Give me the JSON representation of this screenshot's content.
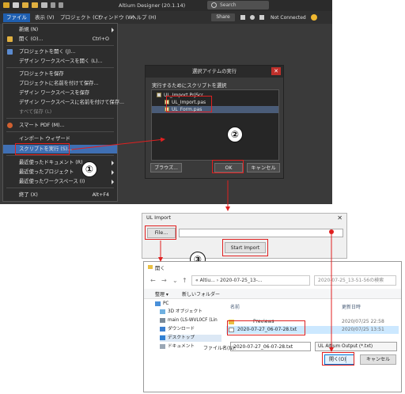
{
  "colors": {
    "accent_red": "#e02020",
    "menu_highlight": "#3f6fb3",
    "altium_bg": "#3a3a3a"
  },
  "altium": {
    "title": "Altium Designer (20.1.14)",
    "search_label": "Search",
    "share_label": "Share",
    "connection_status": "Not Connected",
    "menus": [
      "ファイル (F)",
      "表示 (V)",
      "プロジェクト (C)",
      "ウィンドウ (W)",
      "ヘルプ (H)"
    ],
    "file_menu": {
      "items": [
        {
          "label": "新規 (N)",
          "arrow": true
        },
        {
          "label": "開く (O)...",
          "shortcut": "Ctrl+O"
        },
        {
          "label": "プロジェクトを開く (J)..."
        },
        {
          "label": "デザイン ワークスペースを開く (L)..."
        },
        {
          "label": "プロジェクトを保存"
        },
        {
          "label": "プロジェクトに名前を付けて保存..."
        },
        {
          "label": "デザイン ワークスペースを保存"
        },
        {
          "label": "デザイン ワークスペースに名前を付けて保存..."
        },
        {
          "label": "すべて保存 (L)"
        },
        {
          "label": "スマート PDF (M)..."
        },
        {
          "label": "インポート ウィザード"
        },
        {
          "label": "スクリプトを実行 (S)..."
        },
        {
          "label": "最近使ったドキュメント (R)",
          "arrow": true
        },
        {
          "label": "最近使ったプロジェクト",
          "arrow": true
        },
        {
          "label": "最近使ったワークスペース (I)",
          "arrow": true
        },
        {
          "label": "終了 (X)",
          "shortcut": "Alt+F4"
        }
      ]
    }
  },
  "select_dialog": {
    "title": "選択アイテムの実行",
    "prompt": "実行するためにスクリプトを選択",
    "tree": [
      "UL_Import.PrjScr",
      "UL_Import.pas",
      "UL_Form.pas"
    ],
    "browse_label": "ブラウズ...",
    "ok_label": "OK",
    "cancel_label": "キャンセル"
  },
  "ul_form": {
    "title": "UL Import",
    "close_glyph": "✕",
    "file_button": "File...",
    "start_button": "Start Import"
  },
  "open_dialog": {
    "title": "開く",
    "address": "« Altiu... › 2020-07-25_13-...",
    "search_placeholder": "2020-07-25_13-51-56の検索",
    "organize_label": "整理 ▾",
    "new_folder_label": "新しいフォルダー",
    "nav": [
      {
        "label": "PC",
        "icon": "pc-icon"
      },
      {
        "label": "3D オブジェクト",
        "icon": "3d-objects-icon"
      },
      {
        "label": "main (LS-WVL0CF (Lin",
        "icon": "network-drive-icon"
      },
      {
        "label": "ダウンロード",
        "icon": "downloads-icon"
      },
      {
        "label": "デスクトップ",
        "icon": "desktop-icon"
      },
      {
        "label": "ドキュメント",
        "icon": "documents-icon"
      }
    ],
    "col_name": "名前",
    "col_date": "更新日時",
    "files": [
      {
        "name": "Previews",
        "date": "2020/07/25 22:58"
      },
      {
        "name": "2020-07-27_06-07-28.txt",
        "date": "2020/07/25 13:51"
      }
    ],
    "filename_label": "ファイル名(N):",
    "filename_value": "2020-07-27_06-07-28.txt",
    "filter_value": "UL Altium Output (*.txt)",
    "open_label": "開く(O)",
    "cancel_label": "キャンセル"
  },
  "steps": [
    "①",
    "②",
    "③"
  ]
}
